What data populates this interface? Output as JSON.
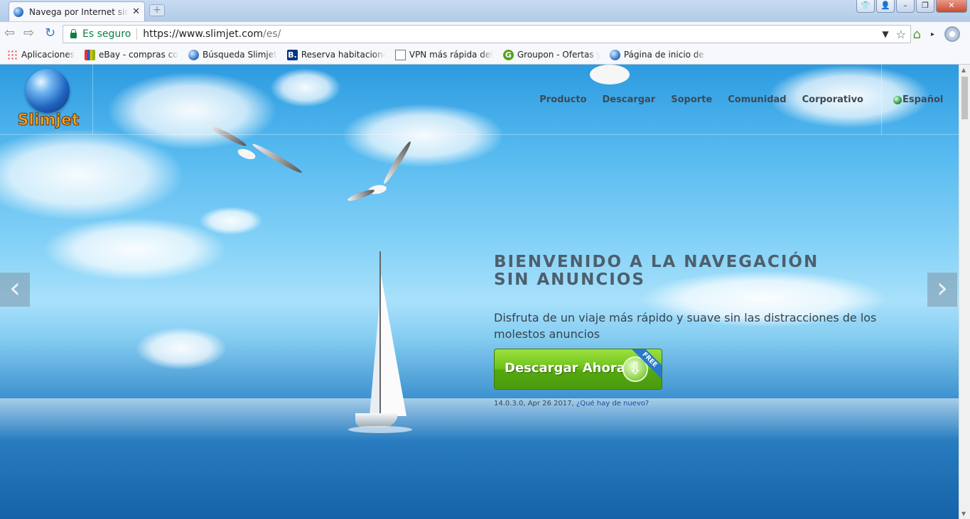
{
  "browser": {
    "tab_title": "Navega por Internet sin anuncios",
    "secure_label": "Es seguro",
    "url_host": "https://www.slimjet.com",
    "url_path": "/es/",
    "bookmarks": [
      {
        "label": "Aplicaciones",
        "icon": "apps-icon"
      },
      {
        "label": "eBay - compras con d",
        "icon": "ebay-icon"
      },
      {
        "label": "Búsqueda Slimjet",
        "icon": "slimjet-globe-icon"
      },
      {
        "label": "Reserva habitaciones",
        "icon": "booking-icon"
      },
      {
        "label": "VPN más rápida del m",
        "icon": "document-icon"
      },
      {
        "label": "Groupon - Ofertas y c",
        "icon": "groupon-icon"
      },
      {
        "label": "Página de inicio de Sli",
        "icon": "slimjet-globe-icon"
      }
    ]
  },
  "site": {
    "logo_text": "Slimjet",
    "nav": [
      "Producto",
      "Descargar",
      "Soporte",
      "Comunidad",
      "Corporativo"
    ],
    "language": "Español",
    "hero": {
      "title_line1": "BIENVENIDO A LA NAVEGACIÓN",
      "title_line2": "SIN ANUNCIOS",
      "subtitle": "Disfruta de un viaje más rápido y suave sin las distracciones de los molestos anuncios",
      "download_label": "Descargar Ahora",
      "badge": "FREE",
      "version": "14.0.3.0, Apr 26 2017,",
      "whats_new": "¿Qué hay de nuevo?"
    }
  },
  "colors": {
    "download_green": "#6cc21b",
    "secure_green": "#0b8043",
    "hero_title": "#4d5f6c"
  }
}
